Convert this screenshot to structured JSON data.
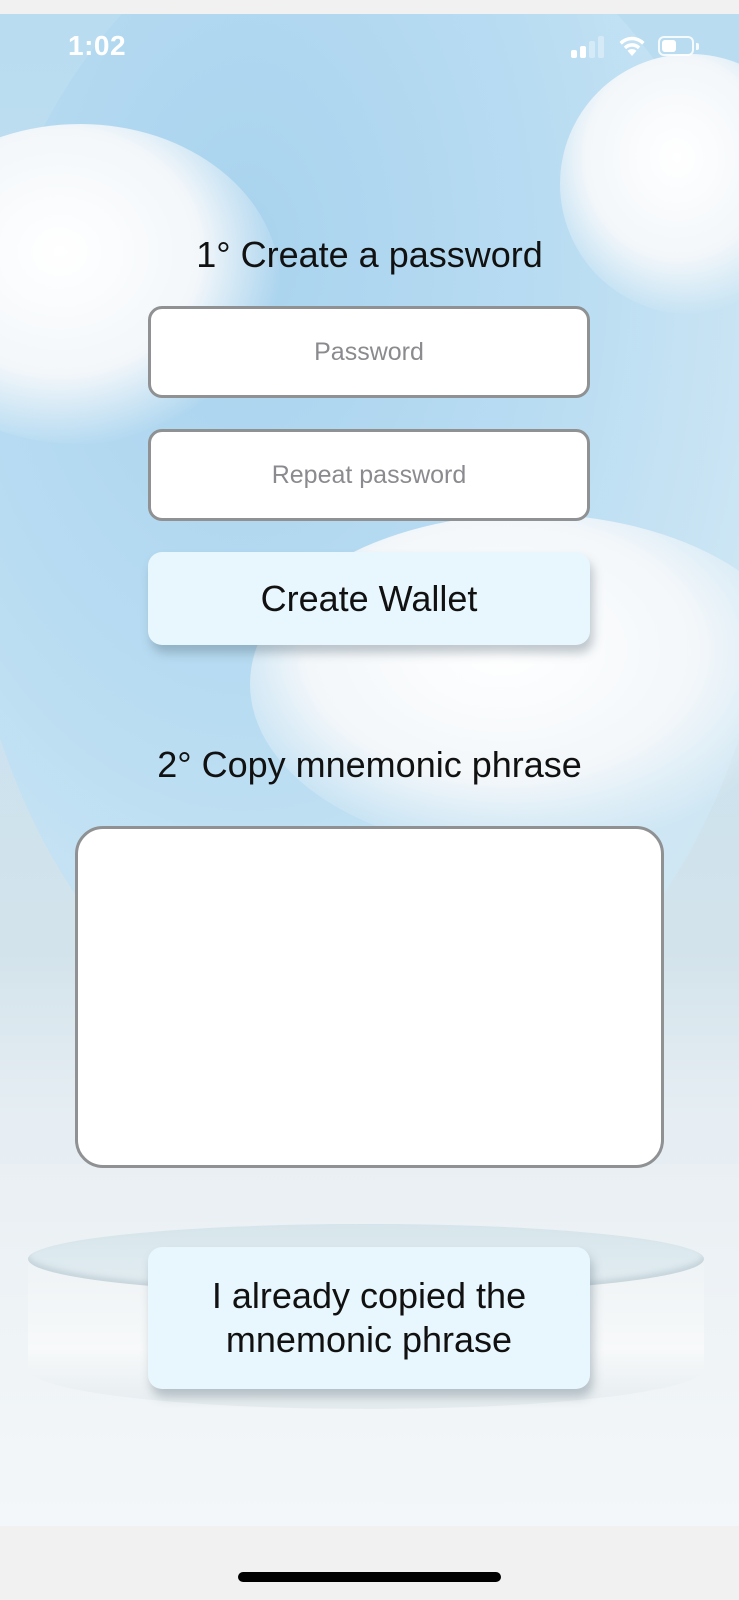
{
  "status_bar": {
    "time": "1:02"
  },
  "step1": {
    "heading": "1° Create a password",
    "password_placeholder": "Password",
    "password_value": "",
    "repeat_placeholder": "Repeat password",
    "repeat_value": "",
    "create_button_label": "Create Wallet"
  },
  "step2": {
    "heading": "2° Copy mnemonic phrase",
    "mnemonic_value": "",
    "confirm_button_label": "I already copied the mnemonic phrase"
  },
  "colors": {
    "button_bg": "#e8f6fd",
    "field_border": "#8f9193",
    "text": "#111111",
    "placeholder": "#8b8b8f"
  },
  "icons": [
    "cellular-signal-icon",
    "wifi-icon",
    "battery-icon"
  ]
}
